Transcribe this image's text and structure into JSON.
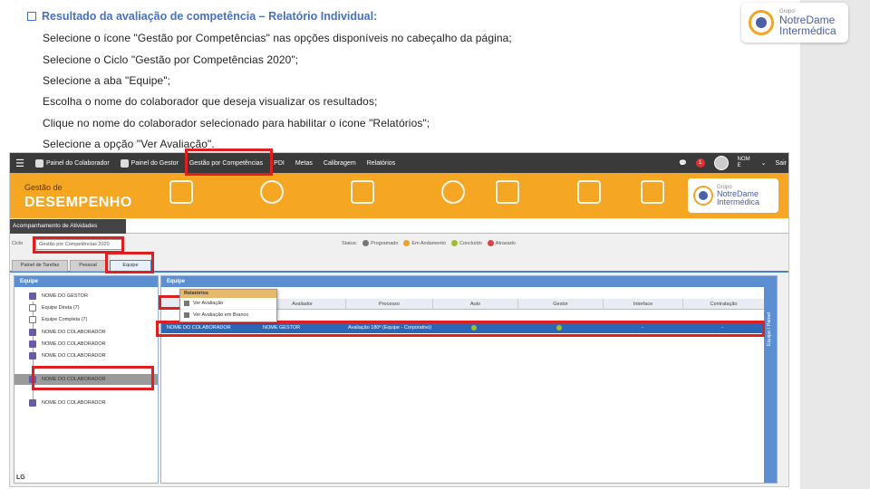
{
  "slide": {
    "title": "Resultado da avaliação de competência – Relatório Individual:",
    "steps": [
      "Selecione o ícone \"Gestão por Competências\" nas opções disponíveis no cabeçalho da página;",
      "Selecione o Ciclo \"Gestão por Competências 2020\";",
      "Selecione a aba \"Equipe\";",
      "Escolha o nome do colaborador que deseja visualizar os resultados;",
      "Clique no nome do colaborador selecionado para habilitar o ícone \"Relatórios\";",
      "Selecione a opção \"Ver Avaliação\"."
    ],
    "logo": {
      "grupo": "Grupo",
      "line1": "NotreDame",
      "line2": "Intermédica"
    }
  },
  "app": {
    "topnav": {
      "items": [
        "Painel do Colaborador",
        "Painel do Gestor",
        "Gestão por Competências",
        "PDI",
        "Metas",
        "Calibragem",
        "Relatórios"
      ],
      "notif_count": "1",
      "user": "NOM E",
      "exit": "Sair"
    },
    "banner": {
      "subtitle": "Gestão de",
      "title": "DESEMPENHO",
      "logo": {
        "grupo": "Grupo",
        "line1": "NotreDame",
        "line2": "Intermédica"
      }
    },
    "subbar_label": "Acompanhamento de Atividades",
    "filter": {
      "cycle_label": "Ciclo",
      "cycle_value": "Gestão por Competências 2020",
      "status_label": "Status:",
      "statuses": [
        {
          "label": "Programado",
          "color": "#777777"
        },
        {
          "label": "Em Andamento",
          "color": "#f0a020"
        },
        {
          "label": "Concluído",
          "color": "#9cc02c"
        },
        {
          "label": "Atrasado",
          "color": "#e04040"
        }
      ]
    },
    "tabs": [
      "Painel de Tarefas",
      "Pessoal",
      "Equipe"
    ],
    "left_panel": {
      "title": "Equipe",
      "rows": [
        "NOME DO GESTOR",
        "Equipe Direta (7)",
        "Equipe Completa (7)",
        "NOME DO COLABORADOR",
        "NOME DO COLABORADOR",
        "NOME DO COLABORADOR",
        "NOME DO COLABORADOR",
        "NOME DO COLABORADOR"
      ]
    },
    "right_panel": {
      "title": "Equipe",
      "menu": {
        "title": "Relatórios",
        "items": [
          "Ver Avaliação",
          "Ver Avaliação em Branco"
        ]
      },
      "columns": [
        "Avaliador",
        "Processo",
        "Auto",
        "Gestor",
        "Interface",
        "Contratação"
      ],
      "row": {
        "avaliado": "NOME DO COLABORADOR",
        "avaliador": "NOME GESTOR",
        "processo": "Avaliação 180º (Equipe - Corporativo)",
        "interface": "-",
        "contratacao": "-"
      },
      "side_tab": "Equipe / Painel"
    },
    "footer": "LG"
  }
}
